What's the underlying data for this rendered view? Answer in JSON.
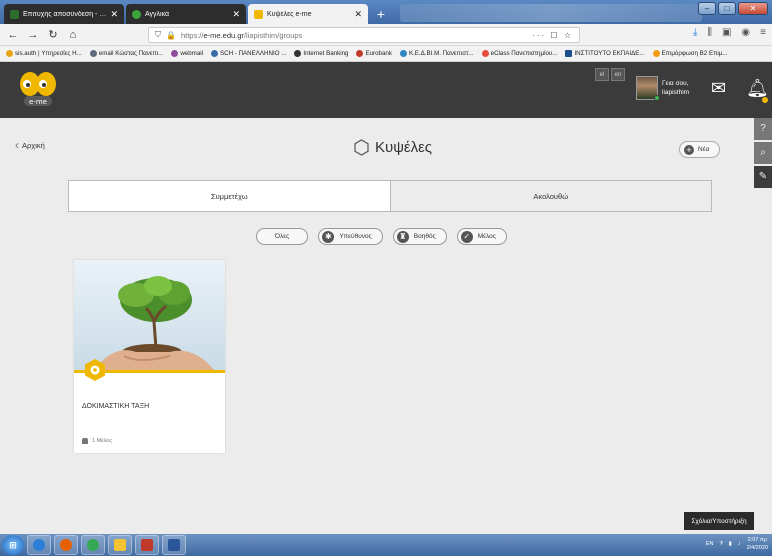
{
  "browser": {
    "tabs": [
      {
        "title": "Επιτυχής αποσύνδεση - CAS - C",
        "color": "#2d6e2d"
      },
      {
        "title": "Αγγλικά",
        "color": "#3aa63a"
      },
      {
        "title": "Κυψέλες e-me",
        "color": "#f0b800"
      }
    ],
    "new_tab": "+",
    "url_prefix": "https://",
    "url_host": "e-me.edu.gr",
    "url_path": "/liapisthim/groups",
    "url_actions": "··· ☐ ☆",
    "bookmarks": [
      "sis.auth | Υπηρεσίες Η...",
      "email Κώστας Πανεπι...",
      "webmail",
      "SCH - ΠΑΝΕΛΛΗΝΙΟ ...",
      "Internet Banking",
      "Eurobank",
      "Κ.Ε.Δ.ΒΙ.Μ. Πανεπιστ...",
      "eClass Πανεπιστημίου...",
      "ΙΝΣΤΙΤΟΥΤΟ ΕΚΠΑΙΔΕ...",
      "Επιμόρφωση Β2 Επιμ..."
    ]
  },
  "header": {
    "lang": [
      "el",
      "en"
    ],
    "greeting": "Γεια σου,",
    "username": "liapisthim"
  },
  "main": {
    "back_label": "Αρχική",
    "title": "Κυψέλες",
    "new_label": "Νέα",
    "tabs": [
      "Συμμετέχω",
      "Ακολουθώ"
    ],
    "filters": [
      "Όλες",
      "Υπεύθυνος",
      "Βοηθός",
      "Μέλος"
    ],
    "card": {
      "title": "ΔΟΚΙΜΑΣΤΙΚΗ ΤΑΞΗ",
      "members": "1 Μέλος"
    },
    "feedback": "Σχόλια/Υποστήριξη"
  },
  "taskbar": {
    "lang": "EN",
    "time": "2:07 πμ",
    "date": "2/4/2020"
  },
  "colors": {
    "accent": "#f0b800",
    "header_bg": "#3b3b3b",
    "page_bg": "#ececec"
  }
}
